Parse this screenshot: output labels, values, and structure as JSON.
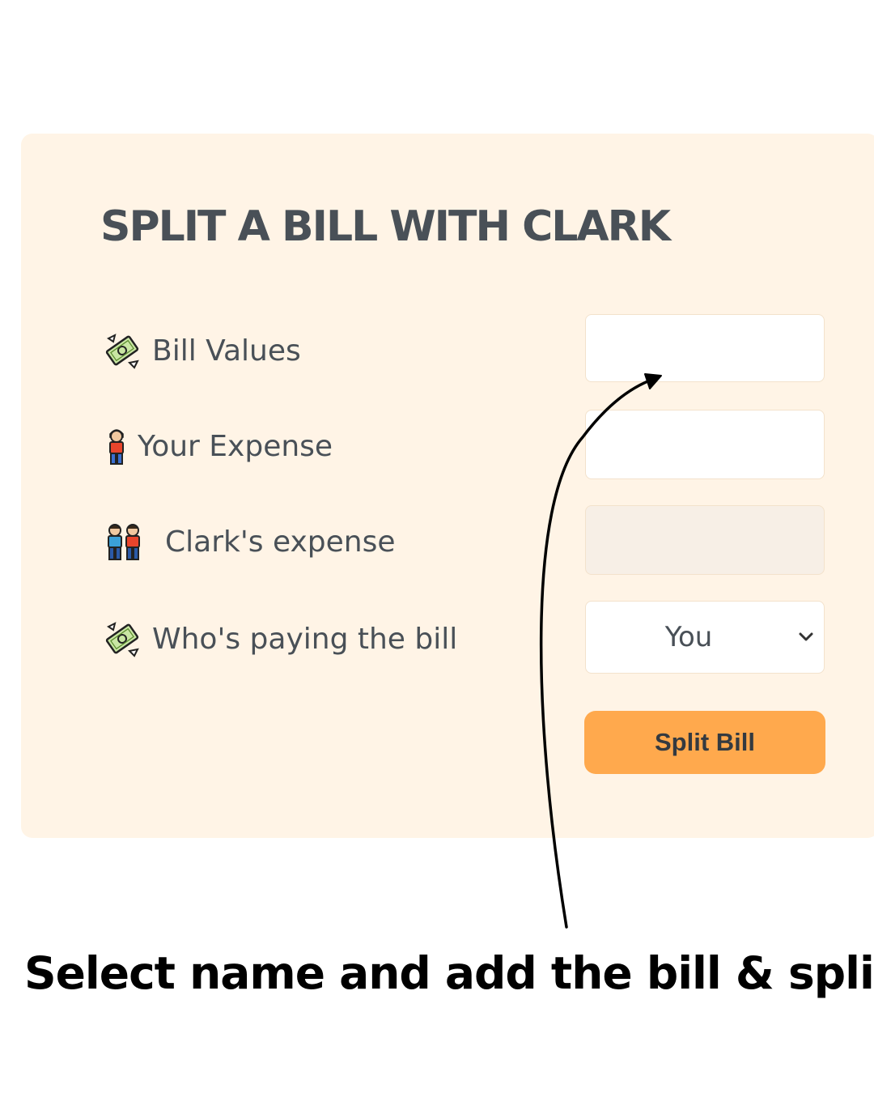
{
  "form": {
    "title": "SPLIT A BILL WITH CLARK",
    "rows": [
      {
        "icon": "money-with-wings-icon",
        "label": "Bill Values",
        "value": ""
      },
      {
        "icon": "person-icon",
        "label": "Your Expense",
        "value": ""
      },
      {
        "icon": "two-people-icon",
        "label": "Clark's expense",
        "value": ""
      },
      {
        "icon": "money-with-wings-icon",
        "label": "Who's paying the bill",
        "selected": "You"
      }
    ],
    "button_label": "Split Bill"
  },
  "caption": "Select name and add the bill & split",
  "colors": {
    "panel_background": "#fff4e6",
    "button_accent": "#ffa94d",
    "text_dark": "#495057"
  }
}
